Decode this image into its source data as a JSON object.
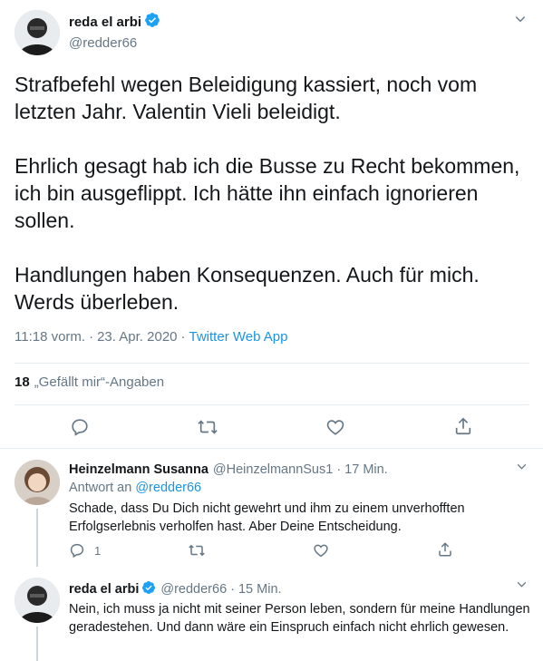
{
  "tweet": {
    "author_name": "reda el arbi",
    "author_handle": "@redder66",
    "paragraphs": [
      "Strafbefehl wegen Beleidigung kassiert, noch vom letzten Jahr. Valentin Vieli beleidigt.",
      "Ehrlich gesagt hab ich die Busse zu Recht bekommen, ich bin ausgeflippt. Ich hätte ihn einfach ignorieren sollen.",
      "Handlungen haben Konsequenzen. Auch für mich. Werds überleben."
    ],
    "time": "11:18 vorm.",
    "separator": "·",
    "date": "23. Apr. 2020",
    "source": "Twitter Web App",
    "likes_count": "18",
    "likes_label": "„Gefällt mir“-Angaben"
  },
  "replies": [
    {
      "author_name": "Heinzelmann Susanna",
      "author_handle": "@HeinzelmannSus1",
      "separator": "·",
      "time": "17 Min.",
      "reply_to_prefix": "Antwort an",
      "reply_to_handle": "@redder66",
      "text": "Schade, dass Du Dich nicht gewehrt und ihm zu einem unverhofften Erfolgserlebnis verholfen hast. Aber Deine Entscheidung.",
      "reply_count": "1"
    },
    {
      "author_name": "reda el arbi",
      "author_handle": "@redder66",
      "separator": "·",
      "time": "15 Min.",
      "text": "Nein, ich muss ja nicht mit seiner Person leben, sondern für meine Handlungen geradestehen. Und dann wäre ein Einspruch einfach nicht ehrlich gewesen."
    }
  ],
  "colors": {
    "link": "#1b95e0",
    "muted": "#657786",
    "divider": "#e6ecf0",
    "verified": "#1da1f2"
  }
}
